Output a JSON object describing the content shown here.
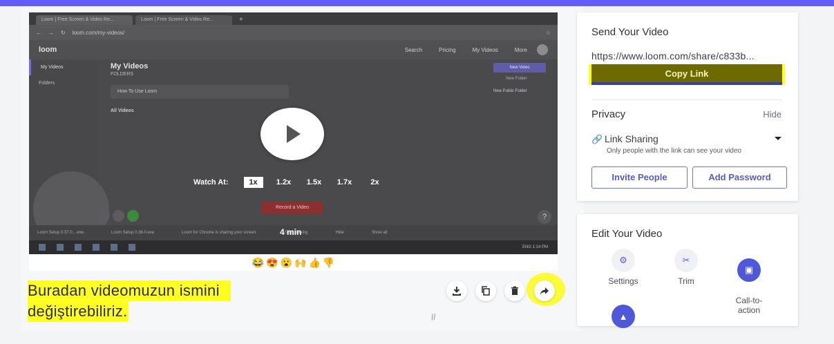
{
  "recorded_screen": {
    "tabs": [
      "Loom | Free Screen & Video Re...",
      "Loom | Free Screen & Video Re..."
    ],
    "url": "loom.com/my-videos/",
    "logo": "loom",
    "nav": [
      "Search",
      "Pricing",
      "My Videos",
      "More"
    ],
    "sidebar": [
      "My Videos",
      "Folders"
    ],
    "main_title": "My Videos",
    "main_subtitle": "FOLDERS",
    "folder_name": "How To Use Loom",
    "all_videos": "All Videos",
    "new_video": "New Video",
    "new_folder": "New Folder",
    "new_public_folder": "New Public Folder",
    "record_button": "Record a Video",
    "download_items": [
      "Loom Setup 0.37.0....exe",
      "Loom Setup 0.36.0.exe"
    ],
    "share_notice": "Loom for Chrome is sharing your screen.",
    "stop_sharing": "Stop sharing",
    "hide": "Hide",
    "show_all": "Show all"
  },
  "player": {
    "watch_at_label": "Watch At:",
    "speeds": [
      "1x",
      "1.2x",
      "1.5x",
      "1.7x",
      "2x"
    ],
    "selected_speed": "1x",
    "duration": "4 min"
  },
  "reactions": [
    "😂",
    "😍",
    "😮",
    "🙌",
    "👍",
    "👎"
  ],
  "video_title_line1": "Buradan videomuzun ismini",
  "video_title_line2": "değiştirebiliriz.",
  "send_panel": {
    "heading": "Send Your Video",
    "share_url": "https://www.loom.com/share/c833b...",
    "copy_link_label": "Copy Link",
    "privacy_heading": "Privacy",
    "hide_label": "Hide",
    "link_sharing_label": "Link Sharing",
    "link_sharing_desc": "Only people with the link can see your video",
    "invite_label": "Invite People",
    "add_password_label": "Add Password"
  },
  "edit_panel": {
    "heading": "Edit Your Video",
    "tools": [
      "Settings",
      "Trim",
      "Call-to-\naction"
    ]
  },
  "colors": {
    "accent": "#625df5",
    "highlight": "#ffff22",
    "copy_link_bg": "#6c6a00",
    "button_border": "#6f72d8"
  }
}
